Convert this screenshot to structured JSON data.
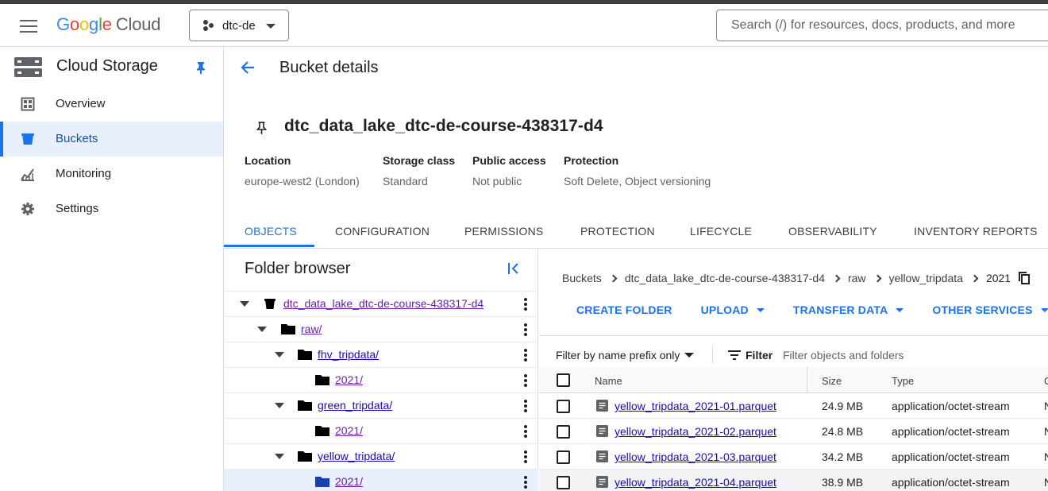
{
  "header": {
    "logo_parts": [
      "G",
      "o",
      "o",
      "g",
      "l",
      "e"
    ],
    "logo_cloud": "Cloud",
    "project": "dtc-de",
    "search_placeholder": "Search (/) for resources, docs, products, and more"
  },
  "sidebar": {
    "product": "Cloud Storage",
    "items": [
      {
        "label": "Overview",
        "icon": "overview-icon",
        "active": false
      },
      {
        "label": "Buckets",
        "icon": "bucket-icon",
        "active": true
      },
      {
        "label": "Monitoring",
        "icon": "monitoring-icon",
        "active": false
      },
      {
        "label": "Settings",
        "icon": "gear-icon",
        "active": false
      }
    ]
  },
  "page": {
    "title": "Bucket details",
    "bucket_name": "dtc_data_lake_dtc-de-course-438317-d4",
    "info": [
      {
        "key": "Location",
        "value": "europe-west2 (London)"
      },
      {
        "key": "Storage class",
        "value": "Standard"
      },
      {
        "key": "Public access",
        "value": "Not public"
      },
      {
        "key": "Protection",
        "value": "Soft Delete, Object versioning"
      }
    ],
    "tabs": [
      "OBJECTS",
      "CONFIGURATION",
      "PERMISSIONS",
      "PROTECTION",
      "LIFECYCLE",
      "OBSERVABILITY",
      "INVENTORY REPORTS"
    ],
    "active_tab": "OBJECTS"
  },
  "folder_browser": {
    "title": "Folder browser",
    "nodes": [
      {
        "label": "dtc_data_lake_dtc-de-course-438317-d4",
        "kind": "bucket"
      },
      {
        "label": "raw/",
        "kind": "folder"
      },
      {
        "label": "fhv_tripdata/",
        "kind": "folder"
      },
      {
        "label": "2021/",
        "kind": "folder"
      },
      {
        "label": "green_tripdata/",
        "kind": "folder"
      },
      {
        "label": "2021/",
        "kind": "folder"
      },
      {
        "label": "yellow_tripdata/",
        "kind": "folder"
      },
      {
        "label": "2021/",
        "kind": "folder",
        "selected": true
      }
    ]
  },
  "objects": {
    "breadcrumb": [
      "Buckets",
      "dtc_data_lake_dtc-de-course-438317-d4",
      "raw",
      "yellow_tripdata",
      "2021"
    ],
    "actions": [
      "CREATE FOLDER",
      "UPLOAD",
      "TRANSFER DATA",
      "OTHER SERVICES"
    ],
    "filter_mode": "Filter by name prefix only",
    "filter_label": "Filter",
    "filter_placeholder": "Filter objects and folders",
    "columns": [
      "Name",
      "Size",
      "Type",
      "C"
    ],
    "rows": [
      {
        "name": "yellow_tripdata_2021-01.parquet",
        "size": "24.9 MB",
        "type": "application/octet-stream",
        "created": "N"
      },
      {
        "name": "yellow_tripdata_2021-02.parquet",
        "size": "24.8 MB",
        "type": "application/octet-stream",
        "created": "N"
      },
      {
        "name": "yellow_tripdata_2021-03.parquet",
        "size": "34.2 MB",
        "type": "application/octet-stream",
        "created": "N"
      },
      {
        "name": "yellow_tripdata_2021-04.parquet",
        "size": "38.9 MB",
        "type": "application/octet-stream",
        "created": "N"
      }
    ]
  },
  "colors": {
    "accent": "#1a73e8",
    "link": "#1a0dab",
    "visited": "#681da8",
    "active_bg": "#e8f0fe"
  }
}
